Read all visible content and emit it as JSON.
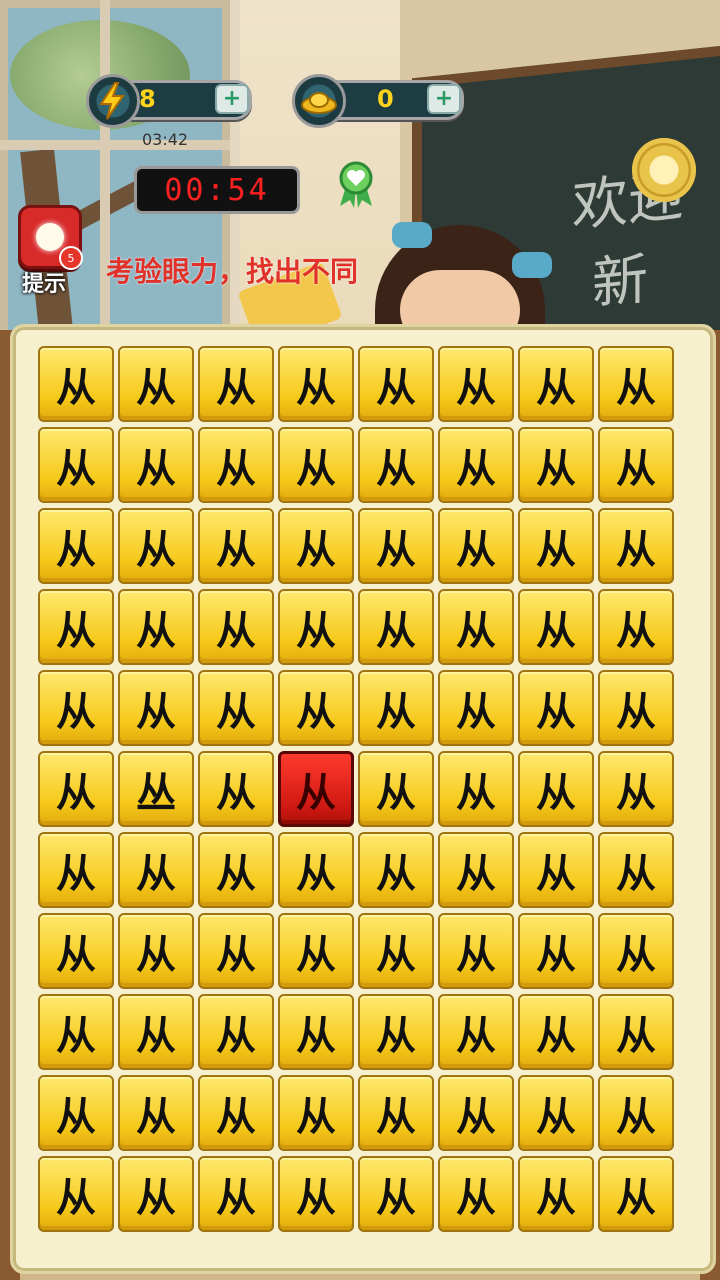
{
  "hud": {
    "energy": {
      "value": "8",
      "icon": "lightning-icon",
      "plus": "+"
    },
    "gold": {
      "value": "0",
      "icon": "gold-ingot-icon",
      "plus": "+"
    },
    "recover_time": "03:42",
    "timer": "00:54"
  },
  "hint": {
    "label": "提示",
    "count": "5"
  },
  "instruction": "考验眼力，找出不同",
  "background": {
    "chalk_1": "欢迎",
    "chalk_2": "新"
  },
  "board": {
    "rows": 11,
    "cols": 8,
    "common_char": "从",
    "odd_char": "丛",
    "odd_position": {
      "row": 6,
      "col": 2
    },
    "selected_position": {
      "row": 6,
      "col": 4
    }
  },
  "colors": {
    "tile": "#f6c91a",
    "selected_tile": "#d31c14",
    "timer_digits": "#ff2121",
    "instruction": "#e1322a"
  }
}
